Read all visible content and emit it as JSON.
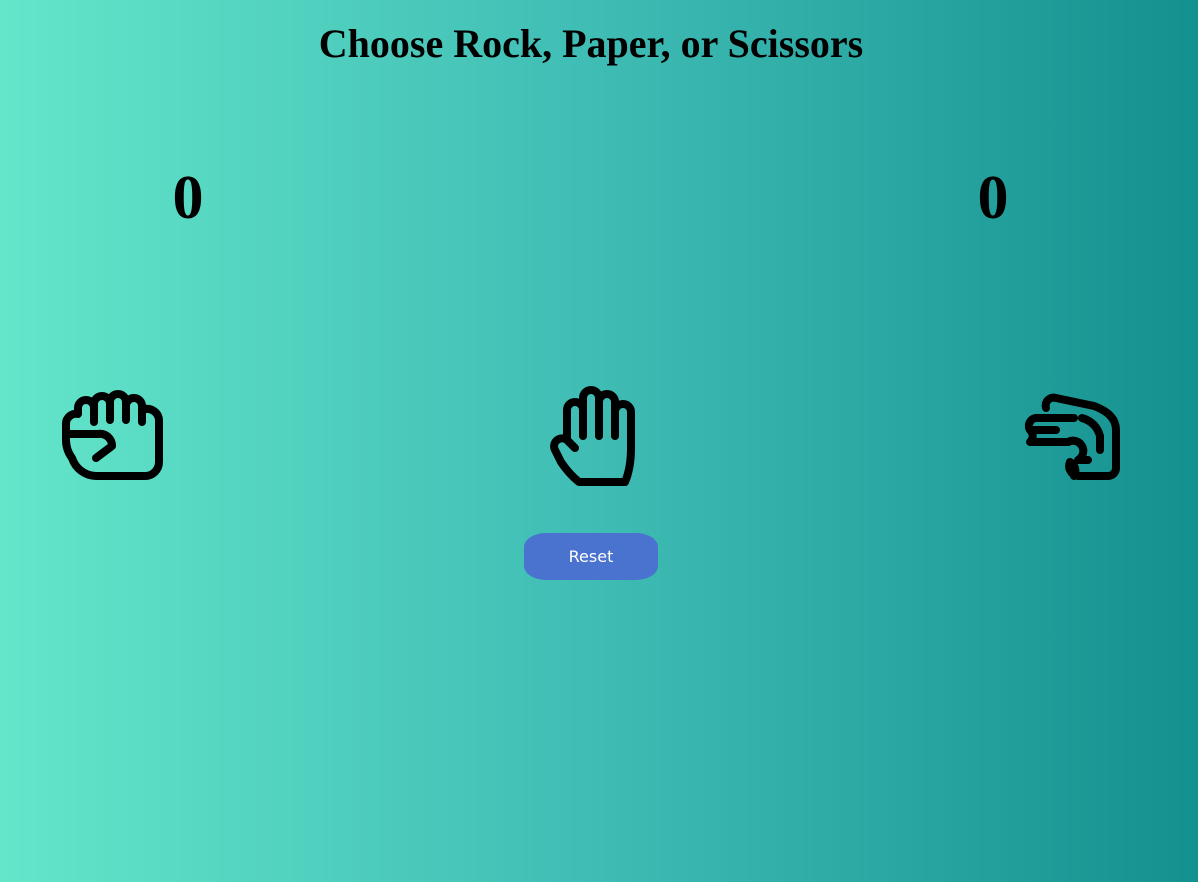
{
  "game": {
    "title": "Choose Rock, Paper, or Scissors",
    "scores": {
      "player": "0",
      "computer": "0"
    },
    "choices": [
      {
        "name": "rock",
        "icon": "hand-fist-icon"
      },
      {
        "name": "paper",
        "icon": "hand-open-icon"
      },
      {
        "name": "scissors",
        "icon": "hand-scissors-icon"
      }
    ],
    "reset_label": "Reset"
  },
  "colors": {
    "background_start": "#63e6ca",
    "background_end": "#14918f",
    "button": "#4a72cf",
    "button_text": "#ffffff",
    "icon_stroke": "#000000"
  }
}
